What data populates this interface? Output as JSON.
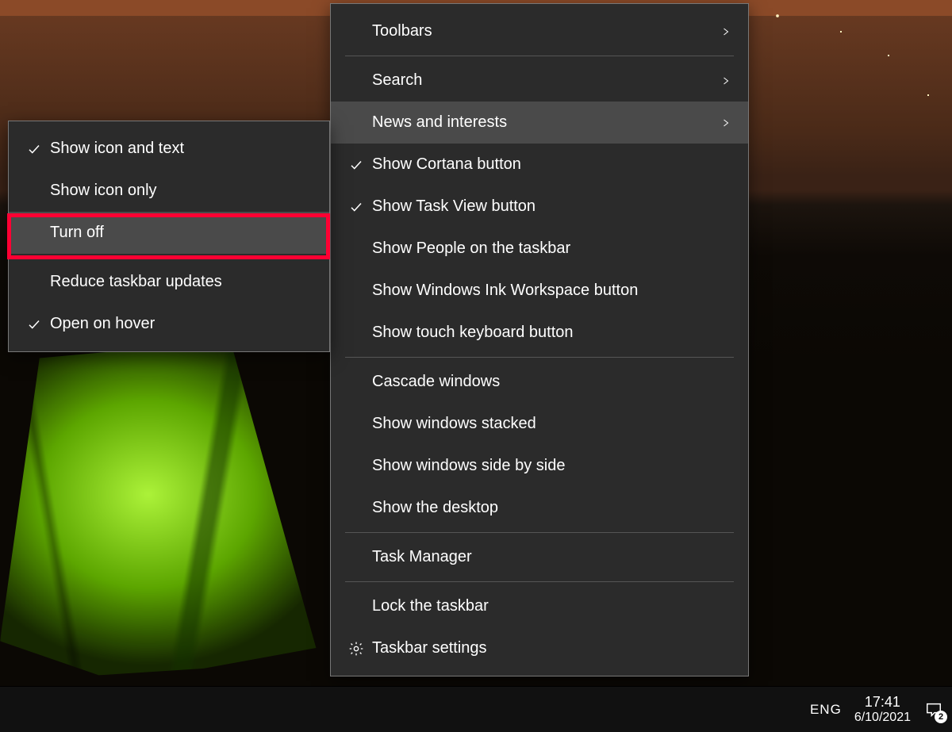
{
  "taskbar": {
    "language": "ENG",
    "time": "17:41",
    "date": "6/10/2021",
    "notification_count": "2"
  },
  "main_menu": {
    "items": [
      {
        "label": "Toolbars",
        "checked": false,
        "arrow": true,
        "hover": false,
        "sep_after": true
      },
      {
        "label": "Search",
        "checked": false,
        "arrow": true,
        "hover": false,
        "sep_after": false
      },
      {
        "label": "News and interests",
        "checked": false,
        "arrow": true,
        "hover": true,
        "sep_after": false
      },
      {
        "label": "Show Cortana button",
        "checked": true,
        "arrow": false,
        "hover": false,
        "sep_after": false
      },
      {
        "label": "Show Task View button",
        "checked": true,
        "arrow": false,
        "hover": false,
        "sep_after": false
      },
      {
        "label": "Show People on the taskbar",
        "checked": false,
        "arrow": false,
        "hover": false,
        "sep_after": false
      },
      {
        "label": "Show Windows Ink Workspace button",
        "checked": false,
        "arrow": false,
        "hover": false,
        "sep_after": false
      },
      {
        "label": "Show touch keyboard button",
        "checked": false,
        "arrow": false,
        "hover": false,
        "sep_after": true
      },
      {
        "label": "Cascade windows",
        "checked": false,
        "arrow": false,
        "hover": false,
        "sep_after": false
      },
      {
        "label": "Show windows stacked",
        "checked": false,
        "arrow": false,
        "hover": false,
        "sep_after": false
      },
      {
        "label": "Show windows side by side",
        "checked": false,
        "arrow": false,
        "hover": false,
        "sep_after": false
      },
      {
        "label": "Show the desktop",
        "checked": false,
        "arrow": false,
        "hover": false,
        "sep_after": true
      },
      {
        "label": "Task Manager",
        "checked": false,
        "arrow": false,
        "hover": false,
        "sep_after": true
      },
      {
        "label": "Lock the taskbar",
        "checked": false,
        "arrow": false,
        "hover": false,
        "sep_after": false
      },
      {
        "label": "Taskbar settings",
        "checked": false,
        "arrow": false,
        "hover": false,
        "sep_after": false,
        "gear": true
      }
    ]
  },
  "sub_menu": {
    "items": [
      {
        "label": "Show icon and text",
        "checked": true,
        "hover": false,
        "sep_after": false,
        "highlighted": false
      },
      {
        "label": "Show icon only",
        "checked": false,
        "hover": false,
        "sep_after": false,
        "highlighted": false
      },
      {
        "label": "Turn off",
        "checked": false,
        "hover": true,
        "sep_after": true,
        "highlighted": true
      },
      {
        "label": "Reduce taskbar updates",
        "checked": false,
        "hover": false,
        "sep_after": false,
        "highlighted": false
      },
      {
        "label": "Open on hover",
        "checked": true,
        "hover": false,
        "sep_after": false,
        "highlighted": false
      }
    ]
  }
}
